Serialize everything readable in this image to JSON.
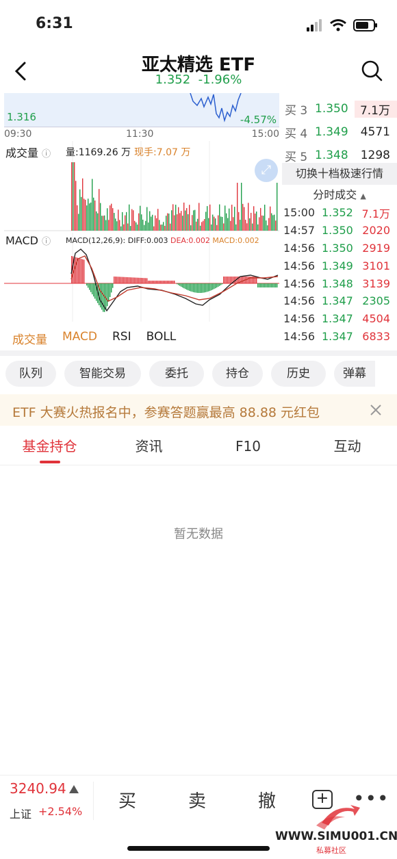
{
  "status": {
    "time": "6:31"
  },
  "header": {
    "title": "亚太精选 ETF",
    "price": "1.352",
    "change": "-1.96%"
  },
  "chart": {
    "low_price": "1.316",
    "low_pct": "-4.57%",
    "time_start": "09:30",
    "time_mid": "11:30",
    "time_end": "15:00",
    "volume_title": "成交量",
    "volume_total": "量:1169.26 万",
    "volume_now": "现手:7.07 万",
    "macd_title": "MACD",
    "macd_params": "MACD(12,26,9):",
    "diff": "DIFF:0.003",
    "dea": "DEA:0.002",
    "macd_val": "MACD:0.002"
  },
  "indicator_tabs": [
    "成交量",
    "MACD",
    "RSI",
    "BOLL"
  ],
  "order_book": [
    {
      "label": "买 3",
      "price": "1.350",
      "volume": "7.1万"
    },
    {
      "label": "买 4",
      "price": "1.349",
      "volume": "4571"
    },
    {
      "label": "买 5",
      "price": "1.348",
      "volume": "1298"
    }
  ],
  "switch_label": "切换十档极速行情",
  "ticks_title": "分时成交",
  "ticks": [
    {
      "time": "15:00",
      "price": "1.352",
      "volume": "7.1万"
    },
    {
      "time": "14:57",
      "price": "1.350",
      "volume": "2020"
    },
    {
      "time": "14:56",
      "price": "1.350",
      "volume": "2919"
    },
    {
      "time": "14:56",
      "price": "1.349",
      "volume": "3101"
    },
    {
      "time": "14:56",
      "price": "1.348",
      "volume": "3139"
    },
    {
      "time": "14:56",
      "price": "1.347",
      "volume": "2305"
    },
    {
      "time": "14:56",
      "price": "1.347",
      "volume": "4504"
    },
    {
      "time": "14:56",
      "price": "1.347",
      "volume": "6833"
    }
  ],
  "pills": [
    "队列",
    "智能交易",
    "委托",
    "持仓",
    "历史",
    "弹幕"
  ],
  "promo": "ETF 大赛火热报名中，参赛答题赢最高 88.88 元红包",
  "content_tabs": [
    "基金持仓",
    "资讯",
    "F10",
    "互动"
  ],
  "empty": "暂无数据",
  "bottom": {
    "index_value": "3240.94",
    "index_name": "上证",
    "index_change": "+2.54%",
    "buy": "买",
    "sell": "卖",
    "cancel": "撤",
    "watermark": "WWW.SIMU001.CN",
    "watermark_sub": "私募社区"
  }
}
